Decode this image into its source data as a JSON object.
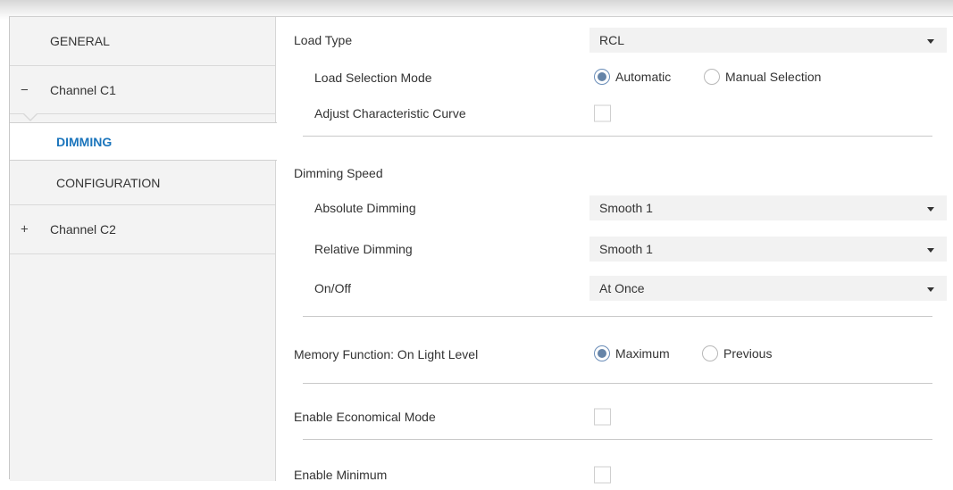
{
  "sidebar": {
    "items": [
      {
        "label": "GENERAL"
      },
      {
        "label": "Channel C1",
        "sign": "−"
      },
      {
        "label": "DIMMING"
      },
      {
        "label": "CONFIGURATION"
      },
      {
        "label": "Channel C2",
        "sign": "+"
      }
    ]
  },
  "load": {
    "type_label": "Load Type",
    "type_value": "RCL",
    "selection_mode_label": "Load Selection Mode",
    "selection_mode_options": [
      "Automatic",
      "Manual Selection"
    ],
    "selection_mode_selected": "Automatic",
    "adjust_curve_label": "Adjust Characteristic Curve",
    "adjust_curve_checked": false
  },
  "dimming_speed": {
    "heading": "Dimming Speed",
    "absolute_label": "Absolute Dimming",
    "absolute_value": "Smooth 1",
    "relative_label": "Relative Dimming",
    "relative_value": "Smooth 1",
    "onoff_label": "On/Off",
    "onoff_value": "At Once"
  },
  "memory": {
    "label": "Memory Function: On Light Level",
    "options": [
      "Maximum",
      "Previous"
    ],
    "selected": "Maximum"
  },
  "economical": {
    "label": "Enable Economical Mode",
    "checked": false
  },
  "minimum": {
    "label": "Enable Minimum",
    "checked": false
  },
  "colors": {
    "accent": "#1b75bc",
    "radio_fill": "#6584a8",
    "sidebar_bg": "#f3f3f3",
    "select_bg": "#f2f2f2"
  },
  "icons": {
    "select_caret": "caret-down-icon",
    "collapse": "minus-icon",
    "expand": "plus-icon"
  }
}
